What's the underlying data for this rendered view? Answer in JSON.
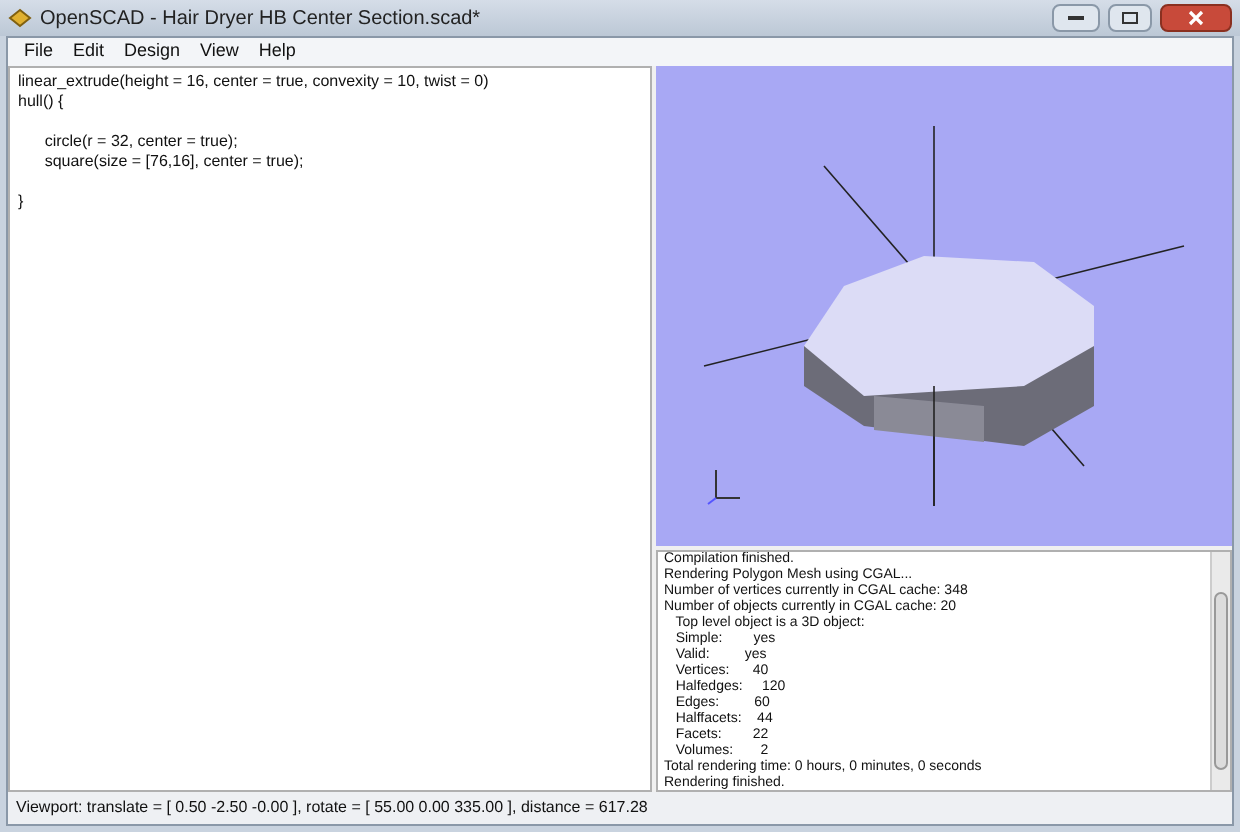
{
  "window": {
    "title": "OpenSCAD - Hair Dryer HB Center Section.scad*"
  },
  "menu": [
    "File",
    "Edit",
    "Design",
    "View",
    "Help"
  ],
  "editor": {
    "paragraphs": [
      [
        "linear_extrude(height = 16, center = true, convexity = 10, twist = 0)",
        "hull() {"
      ],
      [
        "      circle(r = 32, center = true);",
        "      square(size = [76,16], center = true);"
      ],
      [
        "}"
      ]
    ]
  },
  "console": {
    "lines": [
      "Compilation finished.",
      "Rendering Polygon Mesh using CGAL...",
      "Number of vertices currently in CGAL cache: 348",
      "Number of objects currently in CGAL cache: 20",
      "   Top level object is a 3D object:",
      "   Simple:        yes",
      "   Valid:         yes",
      "   Vertices:      40",
      "   Halfedges:     120",
      "   Edges:         60",
      "   Halffacets:    44",
      "   Facets:        22",
      "   Volumes:       2",
      "Total rendering time: 0 hours, 0 minutes, 0 seconds",
      "Rendering finished."
    ]
  },
  "status_bar": "Viewport: translate = [ 0.50 -2.50 -0.00 ], rotate = [ 55.00 0.00 335.00 ], distance = 617.28"
}
